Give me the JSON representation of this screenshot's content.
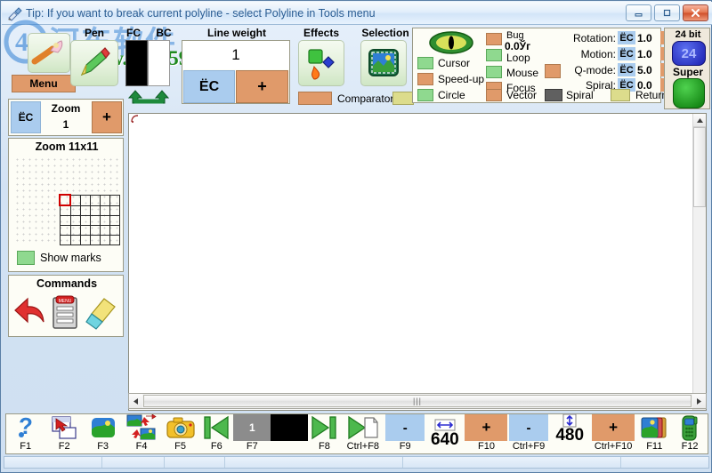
{
  "window": {
    "title": "Tip: If you want to break current polyline - select Polyline in Tools menu",
    "icon": "app-brush-icon",
    "controls": {
      "minimize": "minimize-button",
      "maximize": "maximize-button",
      "close": "close-button"
    }
  },
  "watermark": {
    "text": "www.pc0359.cn"
  },
  "toolbar": {
    "menu": {
      "label": "Menu",
      "icon": "paintbrush-icon"
    },
    "pen": {
      "label": "Pen",
      "icon": "pencil-icon"
    },
    "fc": {
      "label": "FC",
      "color": "#000000"
    },
    "bc": {
      "label": "BC",
      "color": "#ffffff"
    },
    "swap": {
      "icon": "swap-colors-icon"
    },
    "line_weight": {
      "label": "Line weight",
      "value": "1",
      "minus": "ЁС",
      "plus": "+"
    },
    "effects": {
      "label": "Effects",
      "icon": "effects-icon"
    },
    "selection": {
      "label": "Selection",
      "icon": "selection-icon"
    },
    "comparator": {
      "label": "Comparator"
    }
  },
  "options": {
    "eye_icon": "eye-icon",
    "left_toggles": [
      {
        "label": "Cursor",
        "color": "#8fd98f"
      },
      {
        "label": "Speed-up",
        "color": "#e09a6a"
      },
      {
        "label": "Circle",
        "color": "#8fd98f"
      }
    ],
    "mid_toggles": [
      {
        "label": "Bug",
        "color": "#e09a6a",
        "value": "0.0Ўг"
      },
      {
        "label": "Loop",
        "color": "#8fd98f"
      },
      {
        "label": "Mouse",
        "color": "#8fd98f"
      },
      {
        "label": "Focus",
        "color": "#e09a6a"
      },
      {
        "label": "Vector",
        "color": "#e09a6a"
      }
    ],
    "spinners": [
      {
        "label": "Rotation:",
        "minus": "ЁС",
        "value": "1.0",
        "plus": "+"
      },
      {
        "label": "Motion:",
        "minus": "ЁС",
        "value": "1.0",
        "plus": "+"
      },
      {
        "label": "Q-mode:",
        "minus": "ЁС",
        "value": "5.0",
        "plus": "+"
      },
      {
        "label": "Spiral:",
        "minus": "ЁС",
        "value": "0.0",
        "plus": "+"
      }
    ],
    "qmode_swatch": "#e09a6a",
    "spiral_toggle": {
      "label": "Spiral",
      "color": "#606060"
    },
    "return_toggle": {
      "label": "Return",
      "color": "#dcdc8c"
    }
  },
  "depth": {
    "bits_label": "24 bit",
    "badge": "24",
    "super_label": "Super"
  },
  "zoom": {
    "label": "Zoom",
    "value": "1",
    "minus": "ЁС",
    "plus": "+",
    "preview_title": "Zoom 11x11",
    "show_marks": "Show marks"
  },
  "commands": {
    "title": "Commands",
    "items": [
      "undo-arrow-icon",
      "menu-list-icon",
      "eraser-icon"
    ]
  },
  "fkeys": [
    {
      "key": "F1",
      "icon": "help-question-icon"
    },
    {
      "key": "F2",
      "icon": "open-file-icon"
    },
    {
      "key": "F3",
      "icon": "image-landscape-icon"
    },
    {
      "key": "F4",
      "icon": "swap-images-icon"
    },
    {
      "key": "F5",
      "icon": "camera-icon"
    },
    {
      "key": "F6",
      "icon": "prev-frame-icon"
    },
    {
      "key": "F7",
      "icon": "frame-number-icon",
      "value": "1"
    },
    {
      "key": "",
      "icon": "black-frame-icon"
    },
    {
      "key": "F8",
      "icon": "next-frame-icon"
    },
    {
      "key": "Ctrl+F8",
      "icon": "play-to-page-icon"
    },
    {
      "key": "F9",
      "icon": "width-minus-icon",
      "label": "-"
    },
    {
      "key": "",
      "icon": "width-arrows-icon",
      "value": "640"
    },
    {
      "key": "F10",
      "icon": "width-plus-icon",
      "label": "+"
    },
    {
      "key": "Ctrl+F9",
      "icon": "height-minus-icon",
      "label": "-"
    },
    {
      "key": "",
      "icon": "height-arrows-icon",
      "value": "480"
    },
    {
      "key": "Ctrl+F10",
      "icon": "height-plus-icon",
      "label": "+"
    },
    {
      "key": "F11",
      "icon": "layers-icon"
    },
    {
      "key": "F12",
      "icon": "phone-icon"
    }
  ]
}
